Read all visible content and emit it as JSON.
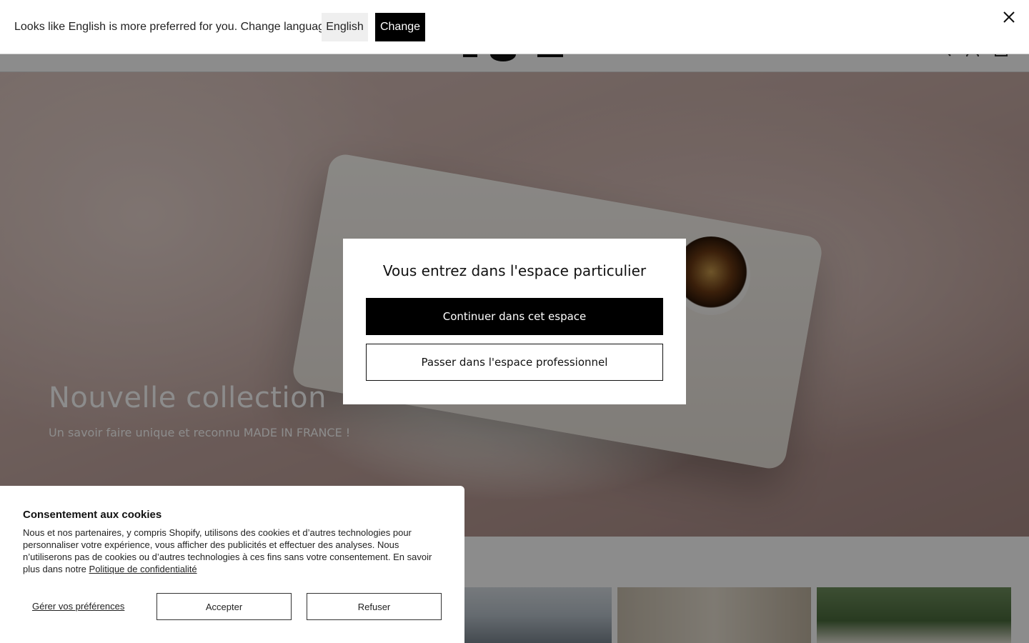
{
  "hero": {
    "title": "Nouvelle collection",
    "subtitle": "Un savoir faire unique et reconnu MADE IN FRANCE !"
  },
  "language_bar": {
    "message": "Looks like English is more preferred for you. Change language?",
    "english_label": "English",
    "change_label": "Change",
    "close_icon": "close-icon"
  },
  "modal": {
    "title": "Vous entrez dans l'espace particulier",
    "continue_label": "Continuer dans cet espace",
    "switch_label": "Passer dans l'espace professionnel"
  },
  "cookie": {
    "title": "Consentement aux cookies",
    "text": "Nous et nos partenaires, y compris Shopify, utilisons des cookies et d’autres technologies pour personnaliser votre expérience, vous afficher des publicités et effectuer des analyses. Nous n’utiliserons pas de cookies ou d’autres technologies à ces fins sans votre consentement. En savoir plus dans notre",
    "policy_link": "Politique de confidentialité",
    "manage_label": "Gérer vos préférences",
    "accept_label": "Accepter",
    "refuse_label": "Refuser"
  },
  "colors": {
    "primary": "#000000",
    "overlay": "rgba(0,0,0,0.45)",
    "background": "#ffffff"
  }
}
